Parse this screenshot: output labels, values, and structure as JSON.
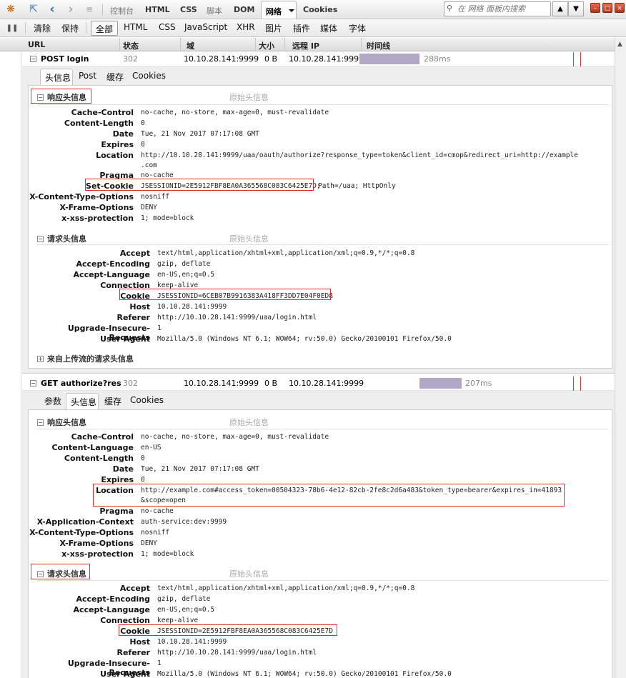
{
  "toolbar": {
    "tabs": [
      "控制台",
      "HTML",
      "CSS",
      "脚本",
      "DOM"
    ],
    "active_tab": "网络",
    "cookies_tab": "Cookies",
    "search_placeholder": "在 网络 面板内搜索"
  },
  "net_toolbar": {
    "clear": "清除",
    "persist": "保持",
    "filters": [
      "全部",
      "HTML",
      "CSS",
      "JavaScript",
      "XHR",
      "图片",
      "插件",
      "媒体",
      "字体"
    ]
  },
  "columns": [
    "URL",
    "状态",
    "域",
    "大小",
    "远程 IP",
    "时间线"
  ],
  "requests": [
    {
      "url": "POST login",
      "status": "302",
      "domain": "10.10.28.141:9999",
      "size": "0 B",
      "remote_ip": "10.10.28.141:9999",
      "time": "288ms",
      "detail_tabs": [
        "头信息",
        "Post",
        "缓存",
        "Cookies"
      ],
      "active_tab": "头信息",
      "response_section": "响应头信息",
      "raw_label": "原始头信息",
      "response_headers": [
        {
          "name": "Cache-Control",
          "value": "no-cache, no-store, max-age=0, must-revalidate"
        },
        {
          "name": "Content-Length",
          "value": "0"
        },
        {
          "name": "Date",
          "value": "Tue, 21 Nov 2017 07:17:08 GMT"
        },
        {
          "name": "Expires",
          "value": "0"
        },
        {
          "name": "Location",
          "value": "http://10.10.28.141:9999/uaa/oauth/authorize?response_type=token&client_id=cmop&redirect_uri=http://example",
          "value2": ".com"
        },
        {
          "name": "Pragma",
          "value": "no-cache"
        },
        {
          "name": "Set-Cookie",
          "value": "JSESSIONID=2E5912FBF8EA0A365568C083C6425E7D;",
          "value_rest": "Path=/uaa; HttpOnly"
        },
        {
          "name": "X-Content-Type-Options",
          "value": "nosniff"
        },
        {
          "name": "X-Frame-Options",
          "value": "DENY"
        },
        {
          "name": "x-xss-protection",
          "value": "1; mode=block"
        }
      ],
      "request_section": "请求头信息",
      "request_headers": [
        {
          "name": "Accept",
          "value": "text/html,application/xhtml+xml,application/xml;q=0.9,*/*;q=0.8"
        },
        {
          "name": "Accept-Encoding",
          "value": "gzip, deflate"
        },
        {
          "name": "Accept-Language",
          "value": "en-US,en;q=0.5"
        },
        {
          "name": "Connection",
          "value": "keep-alive"
        },
        {
          "name": "Cookie",
          "value": "JSESSIONID=6CEB07B9916383A418FF3DD7E04F0ED8"
        },
        {
          "name": "Host",
          "value": "10.10.28.141:9999"
        },
        {
          "name": "Referer",
          "value": "http://10.10.28.141:9999/uaa/login.html"
        },
        {
          "name": "Upgrade-Insecure-Requests",
          "value": "1"
        },
        {
          "name": "User-Agent",
          "value": "Mozilla/5.0 (Windows NT 6.1; WOW64; rv:50.0) Gecko/20100101 Firefox/50.0"
        }
      ],
      "upload_section": "来自上传流的请求头信息"
    },
    {
      "url": "GET authorize?res",
      "status": "302",
      "domain": "10.10.28.141:9999",
      "size": "0 B",
      "remote_ip": "10.10.28.141:9999",
      "time": "207ms",
      "detail_tabs": [
        "参数",
        "头信息",
        "缓存",
        "Cookies"
      ],
      "active_tab": "头信息",
      "response_section": "响应头信息",
      "raw_label": "原始头信息",
      "response_headers": [
        {
          "name": "Cache-Control",
          "value": "no-cache, no-store, max-age=0, must-revalidate"
        },
        {
          "name": "Content-Language",
          "value": "en-US"
        },
        {
          "name": "Content-Length",
          "value": "0"
        },
        {
          "name": "Date",
          "value": "Tue, 21 Nov 2017 07:17:08 GMT"
        },
        {
          "name": "Expires",
          "value": "0"
        },
        {
          "name": "Location",
          "value": "http://example.com#access_token=00504323-78b6-4e12-82cb-2fe8c2d6a483&token_type=bearer&expires_in=41893",
          "value2": "&scope=open"
        },
        {
          "name": "Pragma",
          "value": "no-cache"
        },
        {
          "name": "X-Application-Context",
          "value": "auth-service:dev:9999"
        },
        {
          "name": "X-Content-Type-Options",
          "value": "nosniff"
        },
        {
          "name": "X-Frame-Options",
          "value": "DENY"
        },
        {
          "name": "x-xss-protection",
          "value": "1; mode=block"
        }
      ],
      "request_section": "请求头信息",
      "request_headers": [
        {
          "name": "Accept",
          "value": "text/html,application/xhtml+xml,application/xml;q=0.9,*/*;q=0.8"
        },
        {
          "name": "Accept-Encoding",
          "value": "gzip, deflate"
        },
        {
          "name": "Accept-Language",
          "value": "en-US,en;q=0.5"
        },
        {
          "name": "Connection",
          "value": "keep-alive"
        },
        {
          "name": "Cookie",
          "value": "JSESSIONID=2E5912FBF8EA0A365568C083C6425E7D"
        },
        {
          "name": "Host",
          "value": "10.10.28.141:9999"
        },
        {
          "name": "Referer",
          "value": "http://10.10.28.141:9999/uaa/login.html"
        },
        {
          "name": "Upgrade-Insecure-Requests",
          "value": "1"
        },
        {
          "name": "User-Agent",
          "value": "Mozilla/5.0 (Windows NT 6.1; WOW64; rv:50.0) Gecko/20100101 Firefox/50.0"
        }
      ]
    }
  ]
}
